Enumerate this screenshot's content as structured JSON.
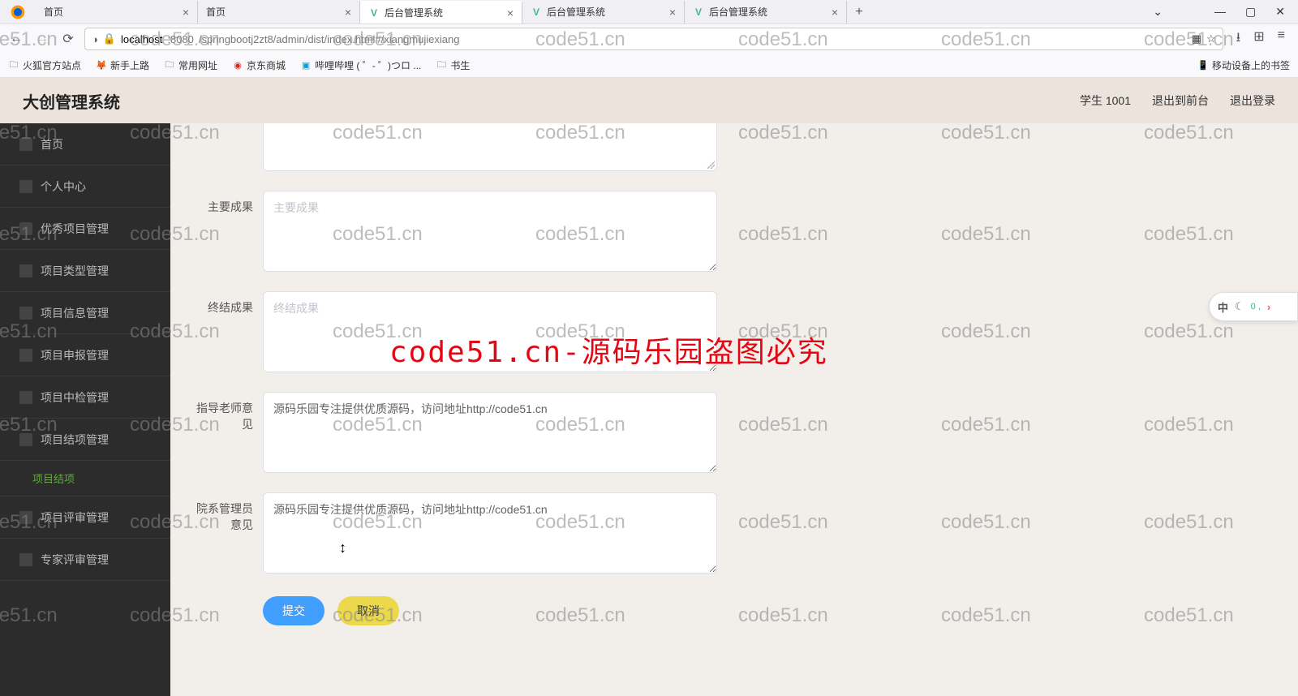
{
  "browser": {
    "tabs": [
      {
        "title": "首页",
        "icon": ""
      },
      {
        "title": "首页",
        "icon": ""
      },
      {
        "title": "后台管理系统",
        "icon": "V",
        "active": true
      },
      {
        "title": "后台管理系统",
        "icon": "V"
      },
      {
        "title": "后台管理系统",
        "icon": "V"
      }
    ],
    "url_host": "localhost",
    "url_port": ":8080",
    "url_path": "/springbootj2zt8/admin/dist/index.html#/xiangmujiexiang",
    "bookmarks": {
      "b1": "火狐官方站点",
      "b2": "新手上路",
      "b3": "常用网址",
      "b4": "京东商城",
      "b5": "哔哩哔哩 ( ゜- ゜)つロ ...",
      "b6": "书生",
      "right": "移动设备上的书签"
    }
  },
  "app": {
    "title": "大创管理系统",
    "user": "学生 1001",
    "link_front": "退出到前台",
    "link_logout": "退出登录"
  },
  "sidebar": {
    "items": [
      {
        "label": "首页"
      },
      {
        "label": "个人中心"
      },
      {
        "label": "优秀项目管理"
      },
      {
        "label": "项目类型管理"
      },
      {
        "label": "项目信息管理"
      },
      {
        "label": "项目申报管理"
      },
      {
        "label": "项目中检管理"
      },
      {
        "label": "项目结项管理"
      },
      {
        "label": "项目结项",
        "sub": true
      },
      {
        "label": "项目评审管理"
      },
      {
        "label": "专家评审管理"
      }
    ]
  },
  "form": {
    "f1_label": "主要成果",
    "f1_placeholder": "主要成果",
    "f2_label": "终结成果",
    "f2_placeholder": "终结成果",
    "f3_label": "指导老师意见",
    "f3_value": "源码乐园专注提供优质源码，访问地址http://code51.cn",
    "f4_label": "院系管理员意见",
    "f4_value": "源码乐园专注提供优质源码，访问地址http://code51.cn",
    "submit": "提交",
    "cancel": "取消"
  },
  "watermark": {
    "text": "code51.cn",
    "big": "code51.cn-源码乐园盗图必究"
  },
  "floatbar": {
    "ch": "中",
    "num": "0 ,"
  }
}
